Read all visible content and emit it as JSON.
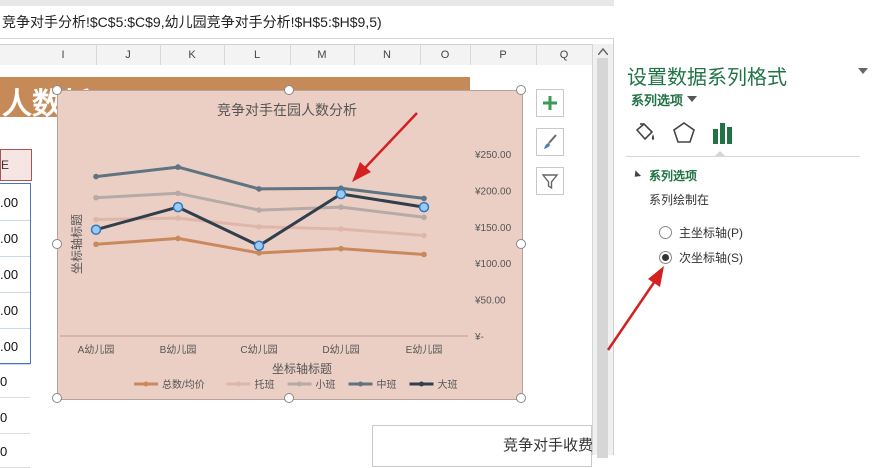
{
  "formula": {
    "text": "竞争对手分析!$C$5:$C$9,幼儿园竞争对手分析!$H$5:$H$9,5)"
  },
  "columns": [
    "I",
    "J",
    "K",
    "L",
    "M",
    "N",
    "O",
    "P",
    "Q"
  ],
  "sheet": {
    "title_fragment": "人数析",
    "header_cell": "E",
    "number_cells": [
      ".00",
      ".00",
      ".00",
      ".00",
      ".00"
    ],
    "plain_cells": [
      "0",
      "0",
      "0"
    ],
    "second_chart_title": "竞争对手收费"
  },
  "chart_data": {
    "type": "line",
    "title": "竞争对手在园人数分析",
    "xlabel": "坐标轴标题",
    "ylabel": "坐标轴标题",
    "categories": [
      "A幼儿园",
      "B幼儿园",
      "C幼儿园",
      "D幼儿园",
      "E幼儿园"
    ],
    "y2_ticks": [
      "¥250.00",
      "¥200.00",
      "¥150.00",
      "¥100.00",
      "¥50.00",
      "¥-"
    ],
    "y2lim": [
      0,
      250
    ],
    "series": [
      {
        "name": "总数/均价",
        "color": "#c9895c",
        "values": [
          126,
          134,
          114,
          120,
          112
        ]
      },
      {
        "name": "托班",
        "color": "#dfb7a8",
        "values": [
          160,
          162,
          150,
          147,
          138
        ]
      },
      {
        "name": "小班",
        "color": "#b5aaa7",
        "values": [
          190,
          196,
          173,
          177,
          163
        ]
      },
      {
        "name": "中班",
        "color": "#5f7380",
        "values": [
          219,
          232,
          202,
          203,
          189
        ]
      },
      {
        "name": "大班",
        "color": "#2f3f4c",
        "values": [
          146,
          177,
          124,
          195,
          177
        ]
      }
    ],
    "selected_series": "大班",
    "legend_position": "bottom",
    "grid": false
  },
  "pane": {
    "title": "设置数据系列格式",
    "subtitle": "系列选项",
    "section_title": "系列选项",
    "plot_on_label": "系列绘制在",
    "options": [
      {
        "label": "主坐标轴(P)",
        "checked": false
      },
      {
        "label": "次坐标轴(S)",
        "checked": true
      }
    ],
    "tabs": [
      "fill-line-icon",
      "effects-pentagon-icon",
      "series-options-bars-icon"
    ]
  },
  "chart_tools": [
    "add-chart-element-icon",
    "chart-styles-brush-icon",
    "chart-filters-icon"
  ],
  "annotation_color": "#d42020"
}
